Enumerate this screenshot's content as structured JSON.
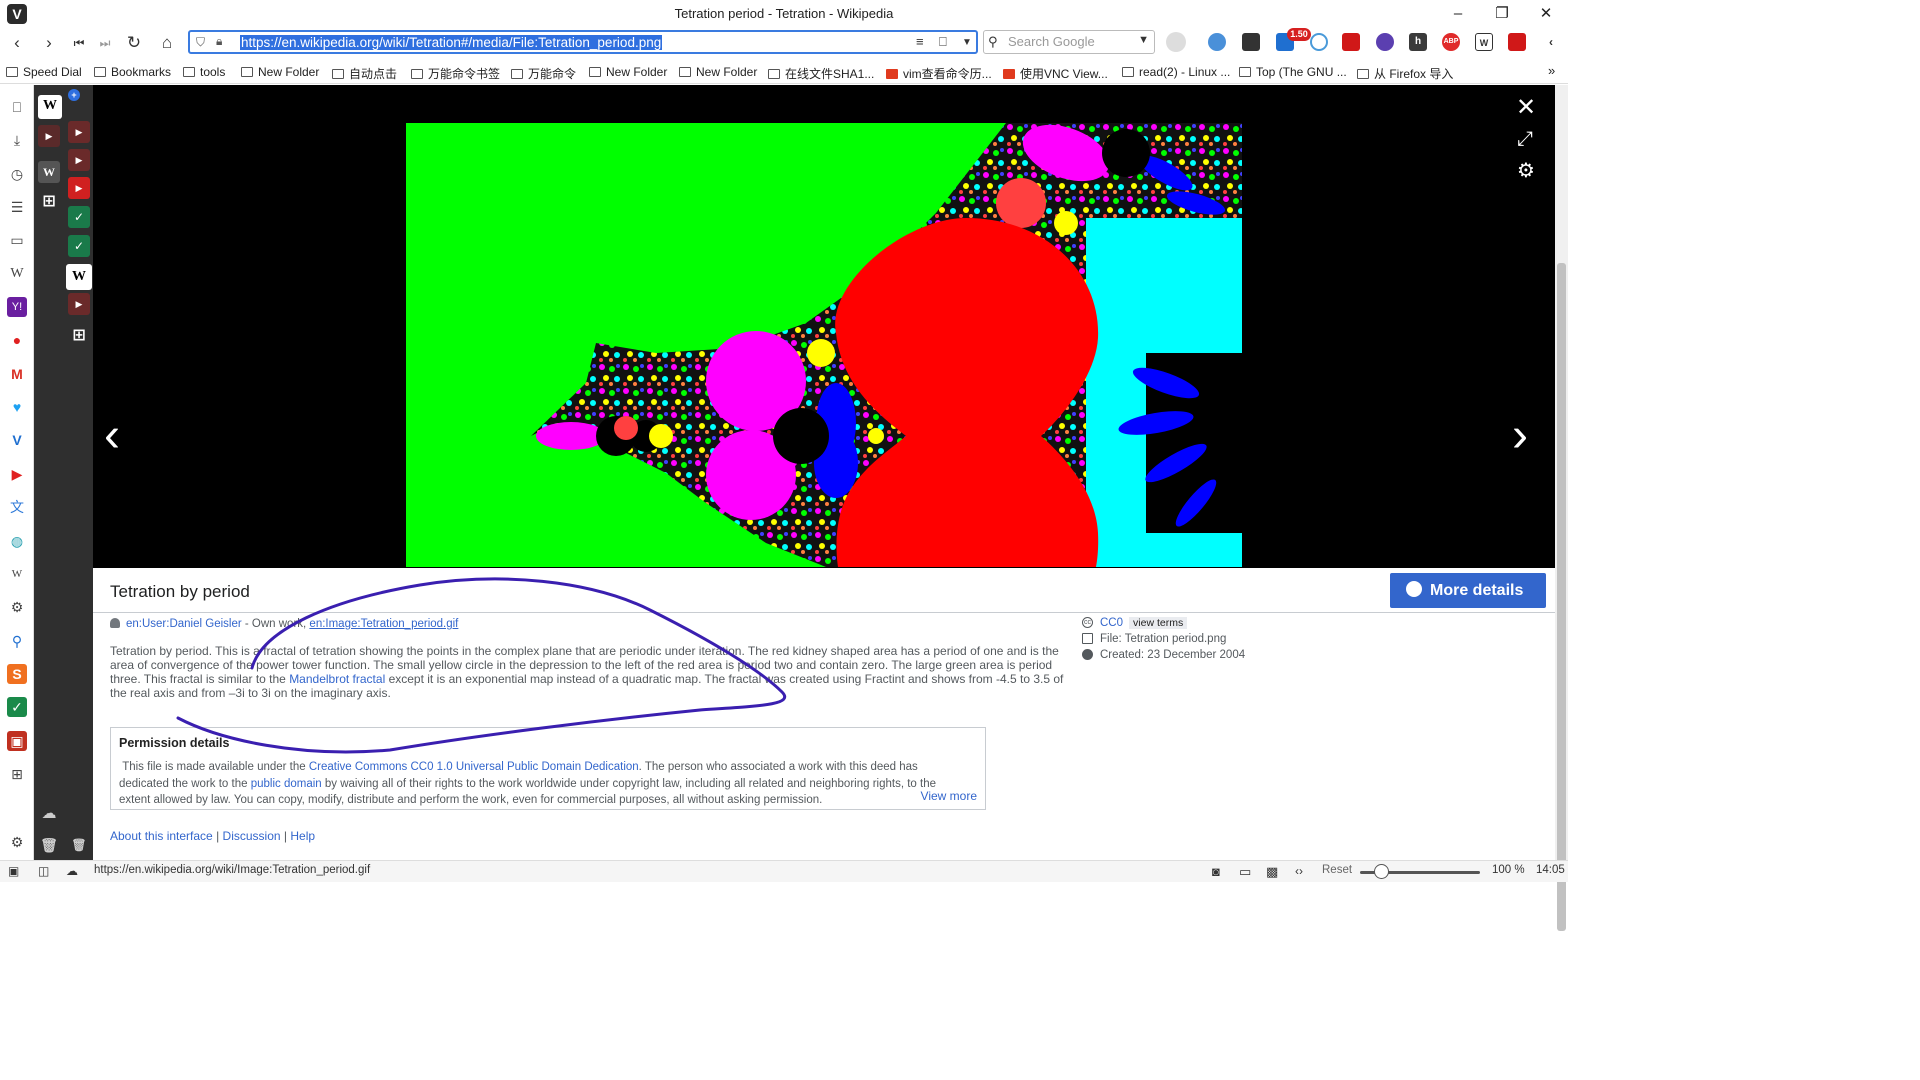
{
  "window": {
    "title": "Tetration period - Tetration - Wikipedia",
    "minimize": "–",
    "restore": "❐",
    "close": "✕"
  },
  "nav": {
    "url": "https://en.wikipedia.org/wiki/Tetration#/media/File:Tetration_period.png",
    "search_placeholder": "Search Google",
    "extension_badge": "1.50"
  },
  "bookmarks": [
    {
      "label": "Speed Dial"
    },
    {
      "label": "Bookmarks"
    },
    {
      "label": "tools"
    },
    {
      "label": "New Folder"
    },
    {
      "label": "自动点击"
    },
    {
      "label": "万能命令书签"
    },
    {
      "label": "万能命令"
    },
    {
      "label": "New Folder"
    },
    {
      "label": "New Folder"
    },
    {
      "label": "在线文件SHA1..."
    },
    {
      "label": "vim查看命令历..."
    },
    {
      "label": "使用VNC View..."
    },
    {
      "label": "read(2) - Linux ..."
    },
    {
      "label": "Top (The GNU ..."
    },
    {
      "label": "从 Firefox 导入"
    }
  ],
  "viewer": {
    "image_alt": "Tetration_period.png fractal",
    "colors": {
      "green": "#00ff00",
      "red": "#ff0000",
      "cyan": "#00ffff",
      "magenta": "#ff00ff",
      "blue": "#0000ff",
      "yellow": "#ffff00"
    }
  },
  "details": {
    "title": "Tetration by period",
    "more_details": "More details",
    "author_user": "en:User:Daniel Geisler",
    "author_sep": " - Own work, ",
    "author_link": "en:Image:Tetration_period.gif",
    "desc_1": "Tetration by period. This is a fractal of tetration showing the points in the complex plane that are periodic under iteration. The red kidney shaped area has a period of one and is the area of convergence of the power tower function. The small yellow circle in the depression to the left of the red area is period two and contain zero. The large green area is period three. This fractal is similar to the ",
    "desc_link": "Mandelbrot fractal",
    "desc_2": " except it is an exponential map instead of a quadratic map. The fractal was created using Fractint and shows from -4.5 to 3.5 of the real axis and from –3i to 3i on the imaginary axis.",
    "permission_heading": "Permission details",
    "perm_1": "This file is made available under the ",
    "perm_link1": "Creative Commons CC0 1.0 Universal Public Domain Dedication",
    "perm_2": ". The person who associated a work with this deed has dedicated the work to the ",
    "perm_link2": "public domain",
    "perm_3": " by waiving all of their rights to the work worldwide under copyright law, including all related and neighboring rights, to the extent allowed by law. You can copy, modify, distribute and perform the work, even for commercial purposes, all without asking permission.",
    "view_more": "View more",
    "license": "CC0",
    "view_terms": "view terms",
    "file": "File: Tetration period.png",
    "created": "Created: 23 December 2004",
    "footer_about": "About this interface",
    "footer_discussion": "Discussion",
    "footer_help": "Help",
    "footer_sep": " | "
  },
  "status": {
    "link_url": "https://en.wikipedia.org/wiki/Image:Tetration_period.gif",
    "reset": "Reset",
    "zoom": "100 %",
    "time": "14:05"
  },
  "annotation_color": "#3a1fb0"
}
